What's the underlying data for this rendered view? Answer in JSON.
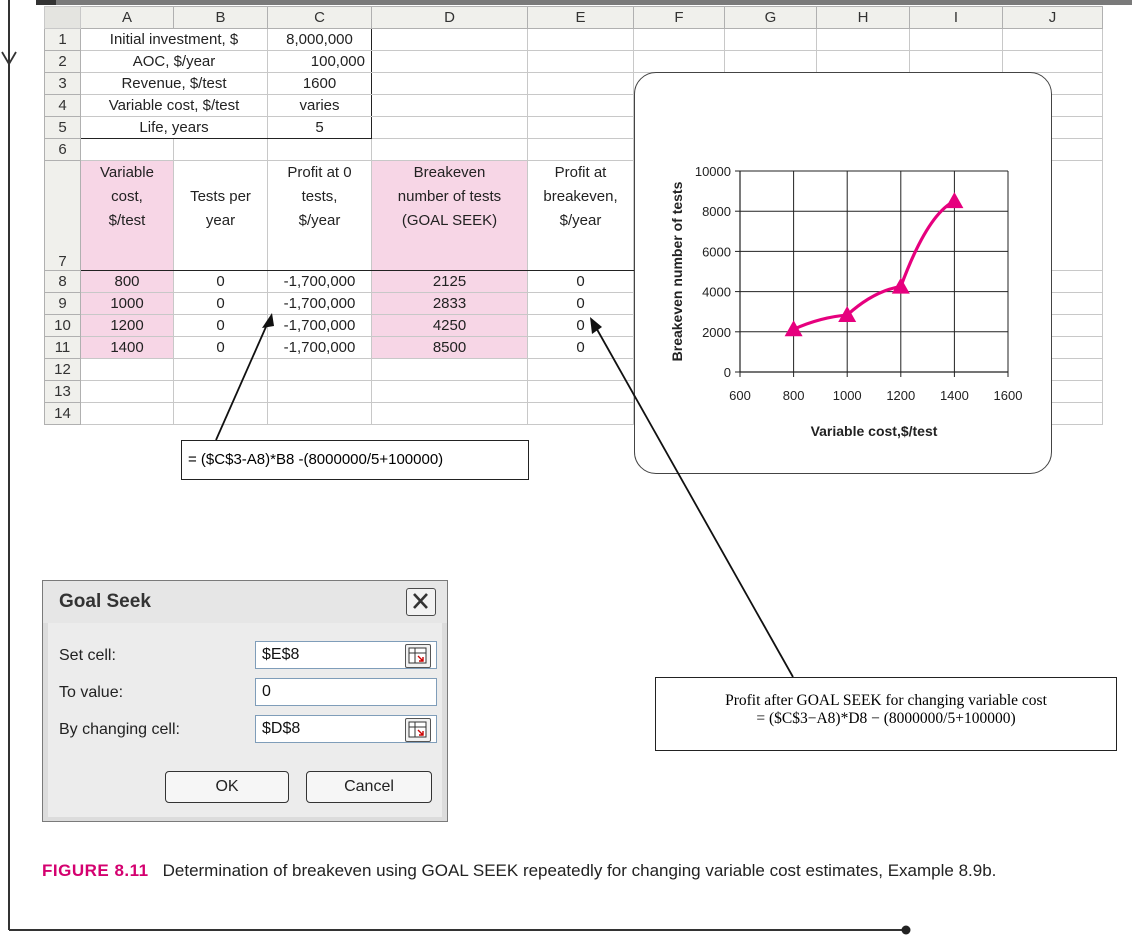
{
  "columns": [
    "A",
    "B",
    "C",
    "D",
    "E",
    "F",
    "G",
    "H",
    "I",
    "J"
  ],
  "rows": {
    "r1": {
      "n": "1",
      "a": "Initial investment, $",
      "c": "8,000,000"
    },
    "r2": {
      "n": "2",
      "a": "AOC, $/year",
      "c": "100,000"
    },
    "r3": {
      "n": "3",
      "a": "Revenue, $/test",
      "c": "1600"
    },
    "r4": {
      "n": "4",
      "a": "Variable cost, $/test",
      "c": "varies"
    },
    "r5": {
      "n": "5",
      "a": "Life, years",
      "c": "5"
    },
    "r6": {
      "n": "6"
    },
    "r7": {
      "n": "7",
      "a": [
        "Variable",
        "cost,",
        "$/test"
      ],
      "b": [
        "Tests per",
        "year"
      ],
      "c": [
        "Profit at 0",
        "tests,",
        "$/year"
      ],
      "d": [
        "Breakeven",
        "number of tests",
        "(GOAL SEEK)"
      ],
      "e": [
        "Profit at",
        "breakeven,",
        "$/year"
      ]
    },
    "data": [
      {
        "n": "8",
        "a": "800",
        "b": "0",
        "c": "-1,700,000",
        "d": "2125",
        "e": "0"
      },
      {
        "n": "9",
        "a": "1000",
        "b": "0",
        "c": "-1,700,000",
        "d": "2833",
        "e": "0"
      },
      {
        "n": "10",
        "a": "1200",
        "b": "0",
        "c": "-1,700,000",
        "d": "4250",
        "e": "0"
      },
      {
        "n": "11",
        "a": "1400",
        "b": "0",
        "c": "-1,700,000",
        "d": "8500",
        "e": "0"
      }
    ],
    "r12": {
      "n": "12"
    },
    "r13": {
      "n": "13"
    },
    "r14": {
      "n": "14"
    }
  },
  "formula_callout": "= ($C$3-A8)*B8 -(8000000/5+100000)",
  "chart_data": {
    "type": "line",
    "x": [
      800,
      1000,
      1200,
      1400
    ],
    "series": [
      {
        "values": [
          2125,
          2833,
          4250,
          8500
        ],
        "color": "#e6007e",
        "marker": "triangle"
      }
    ],
    "xlabel": "Variable cost,$/test",
    "ylabel": "Breakeven number of tests",
    "xlim": [
      600,
      1600
    ],
    "ylim": [
      0,
      10000
    ],
    "xticks": [
      "600",
      "800",
      "1000",
      "1200",
      "1400",
      "1600"
    ],
    "yticks": [
      "0",
      "2000",
      "4000",
      "6000",
      "8000",
      "10000"
    ],
    "grid": true
  },
  "dialog": {
    "title": "Goal Seek",
    "set_cell_label": "Set cell:",
    "set_cell_value": "$E$8",
    "to_value_label": "To value:",
    "to_value_value": "0",
    "by_changing_label": "By changing cell:",
    "by_changing_value": "$D$8",
    "ok": "OK",
    "cancel": "Cancel"
  },
  "callout2": {
    "line1": "Profit after GOAL SEEK for changing variable cost",
    "line2": "= ($C$3−A8)*D8 − (8000000/5+100000)"
  },
  "caption": {
    "figure": "FIGURE 8.11",
    "text": "Determination of breakeven using GOAL SEEK repeatedly for changing variable cost estimates, Example 8.9b."
  },
  "colors": {
    "accent": "#e6007e",
    "pink_fill": "#f7d6e6"
  }
}
